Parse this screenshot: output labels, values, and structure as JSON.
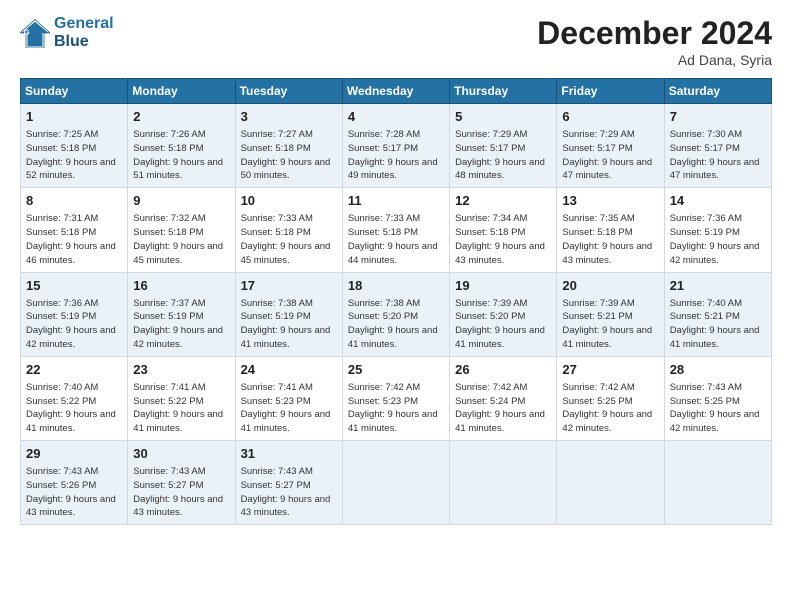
{
  "header": {
    "logo_line1": "General",
    "logo_line2": "Blue",
    "month_title": "December 2024",
    "subtitle": "Ad Dana, Syria"
  },
  "days_of_week": [
    "Sunday",
    "Monday",
    "Tuesday",
    "Wednesday",
    "Thursday",
    "Friday",
    "Saturday"
  ],
  "weeks": [
    [
      {
        "day": "1",
        "sunrise": "7:25 AM",
        "sunset": "5:18 PM",
        "daylight": "9 hours and 52 minutes."
      },
      {
        "day": "2",
        "sunrise": "7:26 AM",
        "sunset": "5:18 PM",
        "daylight": "9 hours and 51 minutes."
      },
      {
        "day": "3",
        "sunrise": "7:27 AM",
        "sunset": "5:18 PM",
        "daylight": "9 hours and 50 minutes."
      },
      {
        "day": "4",
        "sunrise": "7:28 AM",
        "sunset": "5:17 PM",
        "daylight": "9 hours and 49 minutes."
      },
      {
        "day": "5",
        "sunrise": "7:29 AM",
        "sunset": "5:17 PM",
        "daylight": "9 hours and 48 minutes."
      },
      {
        "day": "6",
        "sunrise": "7:29 AM",
        "sunset": "5:17 PM",
        "daylight": "9 hours and 47 minutes."
      },
      {
        "day": "7",
        "sunrise": "7:30 AM",
        "sunset": "5:17 PM",
        "daylight": "9 hours and 47 minutes."
      }
    ],
    [
      {
        "day": "8",
        "sunrise": "7:31 AM",
        "sunset": "5:18 PM",
        "daylight": "9 hours and 46 minutes."
      },
      {
        "day": "9",
        "sunrise": "7:32 AM",
        "sunset": "5:18 PM",
        "daylight": "9 hours and 45 minutes."
      },
      {
        "day": "10",
        "sunrise": "7:33 AM",
        "sunset": "5:18 PM",
        "daylight": "9 hours and 45 minutes."
      },
      {
        "day": "11",
        "sunrise": "7:33 AM",
        "sunset": "5:18 PM",
        "daylight": "9 hours and 44 minutes."
      },
      {
        "day": "12",
        "sunrise": "7:34 AM",
        "sunset": "5:18 PM",
        "daylight": "9 hours and 43 minutes."
      },
      {
        "day": "13",
        "sunrise": "7:35 AM",
        "sunset": "5:18 PM",
        "daylight": "9 hours and 43 minutes."
      },
      {
        "day": "14",
        "sunrise": "7:36 AM",
        "sunset": "5:19 PM",
        "daylight": "9 hours and 42 minutes."
      }
    ],
    [
      {
        "day": "15",
        "sunrise": "7:36 AM",
        "sunset": "5:19 PM",
        "daylight": "9 hours and 42 minutes."
      },
      {
        "day": "16",
        "sunrise": "7:37 AM",
        "sunset": "5:19 PM",
        "daylight": "9 hours and 42 minutes."
      },
      {
        "day": "17",
        "sunrise": "7:38 AM",
        "sunset": "5:19 PM",
        "daylight": "9 hours and 41 minutes."
      },
      {
        "day": "18",
        "sunrise": "7:38 AM",
        "sunset": "5:20 PM",
        "daylight": "9 hours and 41 minutes."
      },
      {
        "day": "19",
        "sunrise": "7:39 AM",
        "sunset": "5:20 PM",
        "daylight": "9 hours and 41 minutes."
      },
      {
        "day": "20",
        "sunrise": "7:39 AM",
        "sunset": "5:21 PM",
        "daylight": "9 hours and 41 minutes."
      },
      {
        "day": "21",
        "sunrise": "7:40 AM",
        "sunset": "5:21 PM",
        "daylight": "9 hours and 41 minutes."
      }
    ],
    [
      {
        "day": "22",
        "sunrise": "7:40 AM",
        "sunset": "5:22 PM",
        "daylight": "9 hours and 41 minutes."
      },
      {
        "day": "23",
        "sunrise": "7:41 AM",
        "sunset": "5:22 PM",
        "daylight": "9 hours and 41 minutes."
      },
      {
        "day": "24",
        "sunrise": "7:41 AM",
        "sunset": "5:23 PM",
        "daylight": "9 hours and 41 minutes."
      },
      {
        "day": "25",
        "sunrise": "7:42 AM",
        "sunset": "5:23 PM",
        "daylight": "9 hours and 41 minutes."
      },
      {
        "day": "26",
        "sunrise": "7:42 AM",
        "sunset": "5:24 PM",
        "daylight": "9 hours and 41 minutes."
      },
      {
        "day": "27",
        "sunrise": "7:42 AM",
        "sunset": "5:25 PM",
        "daylight": "9 hours and 42 minutes."
      },
      {
        "day": "28",
        "sunrise": "7:43 AM",
        "sunset": "5:25 PM",
        "daylight": "9 hours and 42 minutes."
      }
    ],
    [
      {
        "day": "29",
        "sunrise": "7:43 AM",
        "sunset": "5:26 PM",
        "daylight": "9 hours and 43 minutes."
      },
      {
        "day": "30",
        "sunrise": "7:43 AM",
        "sunset": "5:27 PM",
        "daylight": "9 hours and 43 minutes."
      },
      {
        "day": "31",
        "sunrise": "7:43 AM",
        "sunset": "5:27 PM",
        "daylight": "9 hours and 43 minutes."
      },
      null,
      null,
      null,
      null
    ]
  ],
  "labels": {
    "sunrise": "Sunrise:",
    "sunset": "Sunset:",
    "daylight": "Daylight:"
  }
}
